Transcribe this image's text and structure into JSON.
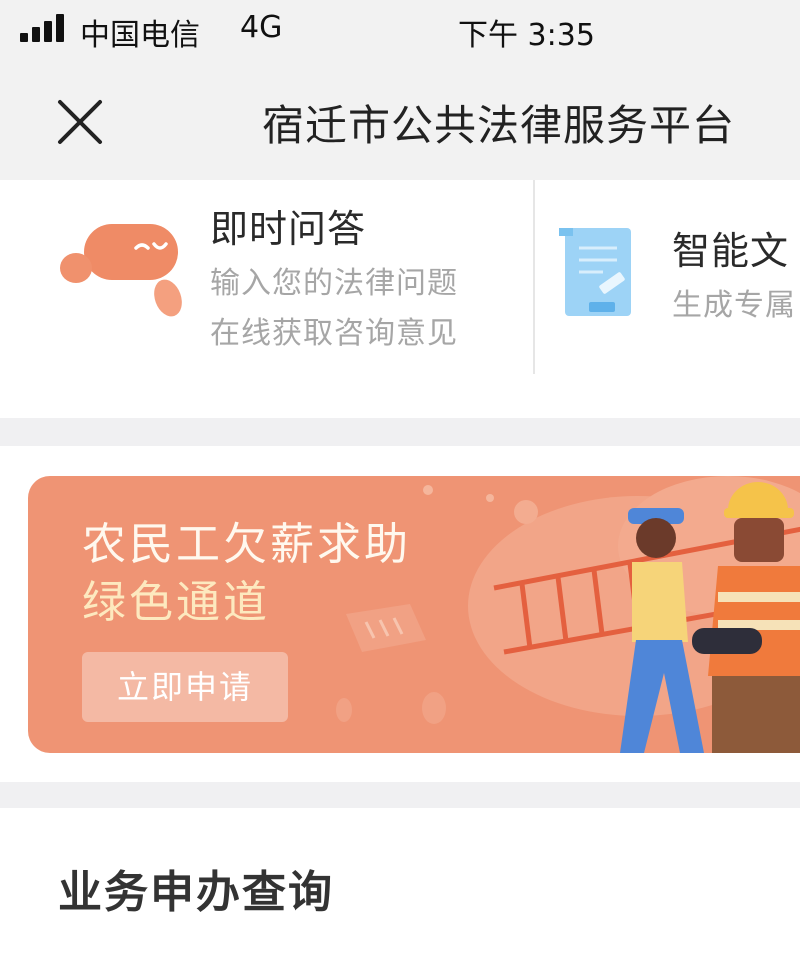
{
  "status_bar": {
    "carrier": "中国电信",
    "network": "4G",
    "time": "下午 3:35"
  },
  "nav": {
    "title": "宿迁市公共法律服务平台"
  },
  "features": [
    {
      "title": "即时问答",
      "desc_line1": "输入您的法律问题",
      "desc_line2": "在线获取咨询意见"
    },
    {
      "title": "智能文",
      "desc_line1": "生成专属"
    }
  ],
  "banner": {
    "title_line1": "农民工欠薪求助",
    "title_line2": "绿色通道",
    "button_label": "立即申请",
    "background_color": "#ef9474"
  },
  "section": {
    "title": "业务申办查询"
  }
}
